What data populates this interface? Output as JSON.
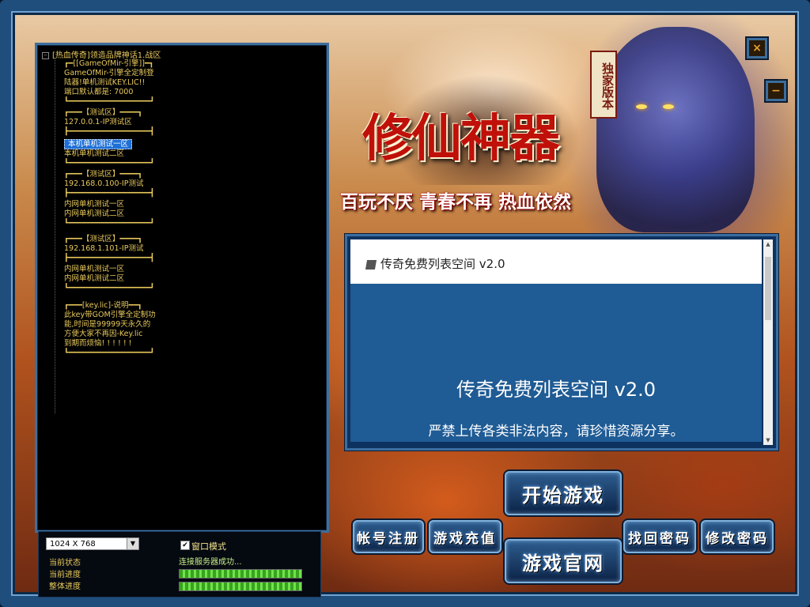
{
  "window": {
    "close_label": "×",
    "minimize_label": "−"
  },
  "banner": {
    "badge": "独家版本",
    "logo_text": "修仙神器",
    "slogan": "百玩不厌 青春不再 热血依然"
  },
  "server_tree": {
    "root_label": "[热血传奇]领造品牌神话1.战区",
    "items": [
      {
        "label": "┏━[[GameOfMir-引擎]]━┓",
        "selected": false
      },
      {
        "label": "GameOfMir-引擎全定制登",
        "selected": false
      },
      {
        "label": "陆器!单机测试KEY.LIC!!",
        "selected": false
      },
      {
        "label": "端口默认都是: 7000",
        "selected": false
      },
      {
        "label": "┗━━━━━━━━━━━━━━━━━━┛",
        "selected": false
      },
      {
        "label": "┏━━━【测试区】━━━━┓",
        "selected": false
      },
      {
        "label": "127.0.0.1-IP测试区",
        "selected": false
      },
      {
        "label": "┣━━━━━━━━━━━━━━━━━━┫",
        "selected": false
      },
      {
        "label": "本机单机测试一区",
        "selected": true
      },
      {
        "label": "本机单机测试二区",
        "selected": false
      },
      {
        "label": "┗━━━━━━━━━━━━━━━━━━┛",
        "selected": false
      },
      {
        "label": "┏━━━【测试区】━━━━┓",
        "selected": false
      },
      {
        "label": "192.168.0.100-IP测试",
        "selected": false
      },
      {
        "label": "┣━━━━━━━━━━━━━━━━━━┫",
        "selected": false
      },
      {
        "label": "内网单机测试一区",
        "selected": false
      },
      {
        "label": "内网单机测试二区",
        "selected": false
      },
      {
        "label": "┗━━━━━━━━━━━━━━━━━━┛",
        "selected": false
      },
      {
        "label": "┏━━━【测试区】━━━━┓",
        "selected": false
      },
      {
        "label": "192.168.1.101-IP测试",
        "selected": false
      },
      {
        "label": "┣━━━━━━━━━━━━━━━━━━┫",
        "selected": false
      },
      {
        "label": "内网单机测试一区",
        "selected": false
      },
      {
        "label": "内网单机测试二区",
        "selected": false
      },
      {
        "label": "┗━━━━━━━━━━━━━━━━━━┛",
        "selected": false
      },
      {
        "label": "┏━━━[key.lic]-说明━━┓",
        "selected": false
      },
      {
        "label": "此key带GOM引擎全定制功",
        "selected": false
      },
      {
        "label": "能,时间是99999天永久的",
        "selected": false
      },
      {
        "label": "方便大家不再因-Key.lic",
        "selected": false
      },
      {
        "label": "到期而烦恼! ! ! ! ! !",
        "selected": false
      },
      {
        "label": "┗━━━━━━━━━━━━━━━━━━┛",
        "selected": false
      }
    ]
  },
  "bottom_panel": {
    "resolution": "1024 X 768",
    "status_label": "当前状态",
    "progress_label": "当前进度",
    "total_label": "整体进度",
    "window_mode_label": "窗口模式",
    "window_mode_checked": "✔",
    "server_status": "连接服务器成功...",
    "current_progress": 1.0,
    "total_progress": 1.0
  },
  "notice": {
    "header_title": "传奇免费列表空间 v2.0",
    "headline": "传奇免费列表空间 v2.0",
    "message": "严禁上传各类非法内容，请珍惜资源分享。"
  },
  "buttons": {
    "start_game": "开始游戏",
    "register": "帐号注册",
    "recharge": "游戏充值",
    "recover_password": "找回密码",
    "change_password": "修改密码",
    "official_site": "游戏官网"
  }
}
